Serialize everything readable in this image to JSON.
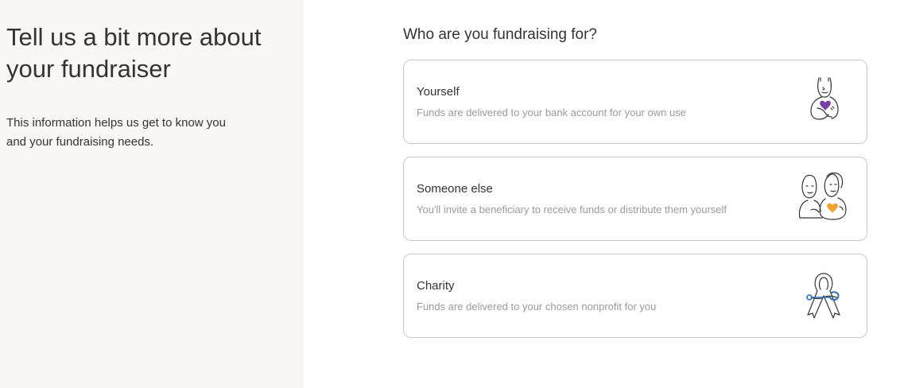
{
  "intro": {
    "title": "Tell us a bit more about your fundraiser",
    "description": "This information helps us get to know you and your fundraising needs."
  },
  "question": "Who are you fundraising for?",
  "options": [
    {
      "title": "Yourself",
      "description": "Funds are delivered to your bank account for your own use",
      "icon": "person-with-heart-icon",
      "accent": "#7a3fa6"
    },
    {
      "title": "Someone else",
      "description": "You'll invite a beneficiary to receive funds or distribute them yourself",
      "icon": "two-people-with-heart-icon",
      "accent": "#f0a531"
    },
    {
      "title": "Charity",
      "description": "Funds are delivered to your chosen nonprofit for you",
      "icon": "charity-ribbon-icon",
      "accent": "#2d6fb8"
    }
  ]
}
